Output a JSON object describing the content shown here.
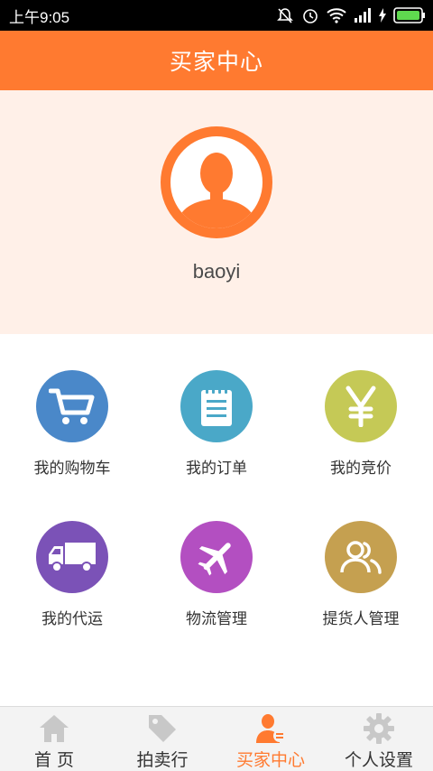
{
  "status_bar": {
    "time": "上午9:05"
  },
  "header": {
    "title": "买家中心"
  },
  "profile": {
    "username": "baoyi"
  },
  "menu": {
    "items": [
      {
        "label": "我的购物车",
        "icon": "cart-icon",
        "color": "#4a88c9"
      },
      {
        "label": "我的订单",
        "icon": "notepad-icon",
        "color": "#4aa8c8"
      },
      {
        "label": "我的竞价",
        "icon": "yen-icon",
        "color": "#c5c956"
      },
      {
        "label": "我的代运",
        "icon": "truck-icon",
        "color": "#7b52b7"
      },
      {
        "label": "物流管理",
        "icon": "airplane-icon",
        "color": "#b34fc1"
      },
      {
        "label": "提货人管理",
        "icon": "people-icon",
        "color": "#c5a050"
      }
    ]
  },
  "tab_bar": {
    "tabs": [
      {
        "label": "首 页",
        "icon": "home-icon"
      },
      {
        "label": "拍卖行",
        "icon": "tag-icon"
      },
      {
        "label": "买家中心",
        "icon": "buyer-icon",
        "active": true
      },
      {
        "label": "个人设置",
        "icon": "gear-icon"
      }
    ]
  },
  "colors": {
    "accent": "#ff7a30",
    "profile_bg": "#fff0e8"
  }
}
